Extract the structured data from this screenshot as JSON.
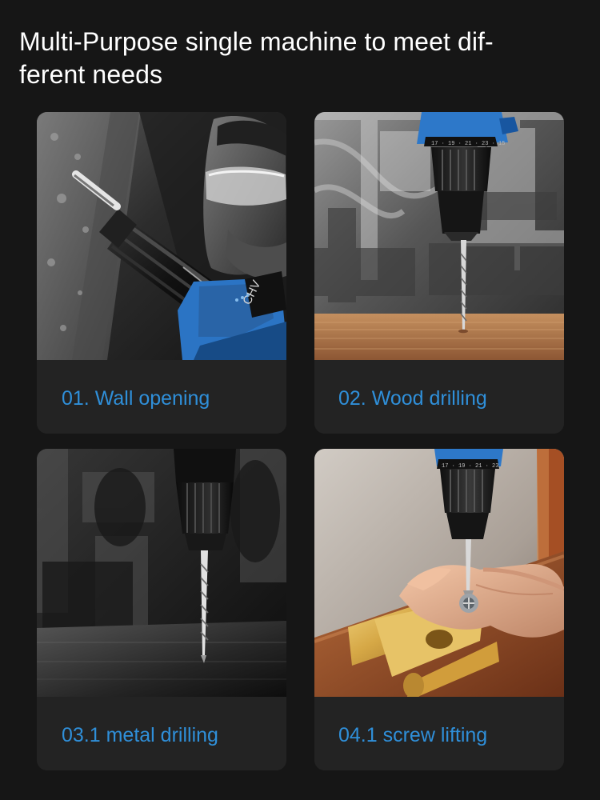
{
  "headline": "Multi-Purpose single machine to meet dif-\nferent needs",
  "colors": {
    "page_background": "#161616",
    "card_background": "#232323",
    "caption_text": "#2f8fd9",
    "headline_text": "#ffffff",
    "tool_blue": "#2d78c9"
  },
  "cards": [
    {
      "caption": "01. Wall opening",
      "photo_subject": "worker-with-safety-glasses-drilling-concrete-wall"
    },
    {
      "caption": "02. Wood drilling",
      "photo_subject": "drill-bit-entering-wood-plank-in-workshop"
    },
    {
      "caption": "03.1 metal drilling",
      "photo_subject": "drill-bit-over-metal-surface-dark-workshop"
    },
    {
      "caption": "04.1 screw lifting",
      "photo_subject": "screwdriver-bit-fastening-brass-hinge-on-wood"
    }
  ]
}
